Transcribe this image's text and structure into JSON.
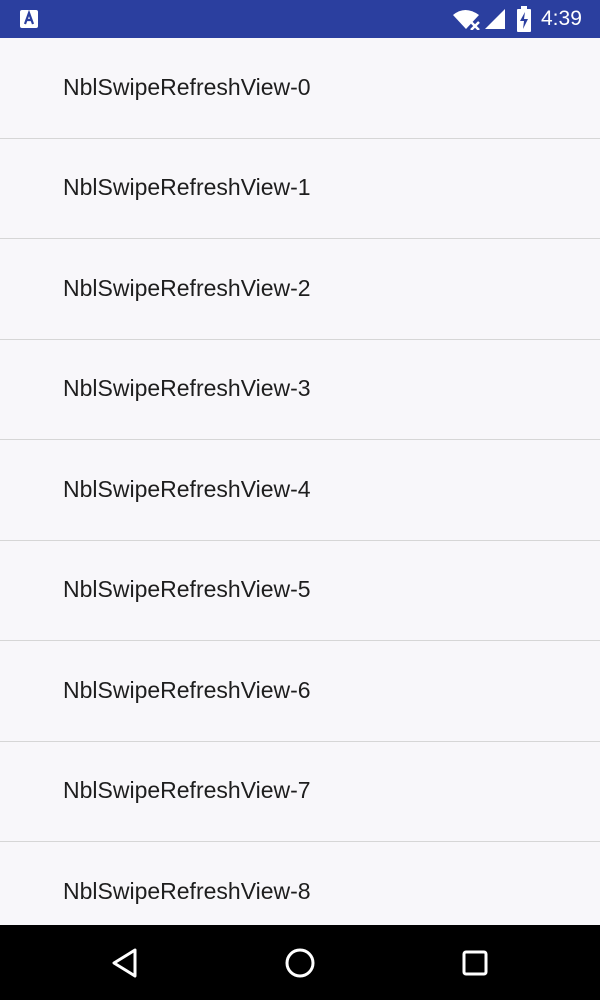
{
  "status_bar": {
    "time": "4:39",
    "app_icon": "app-notification-icon",
    "wifi_icon": "wifi-icon",
    "signal_icon": "signal-icon",
    "battery_icon": "battery-charging-icon",
    "background_color": "#2b3f9f"
  },
  "list": {
    "items": [
      {
        "label": "NblSwipeRefreshView-0"
      },
      {
        "label": "NblSwipeRefreshView-1"
      },
      {
        "label": "NblSwipeRefreshView-2"
      },
      {
        "label": "NblSwipeRefreshView-3"
      },
      {
        "label": "NblSwipeRefreshView-4"
      },
      {
        "label": "NblSwipeRefreshView-5"
      },
      {
        "label": "NblSwipeRefreshView-6"
      },
      {
        "label": "NblSwipeRefreshView-7"
      },
      {
        "label": "NblSwipeRefreshView-8"
      }
    ]
  },
  "nav_bar": {
    "back_icon": "back-triangle-icon",
    "home_icon": "home-circle-icon",
    "recents_icon": "recents-square-icon"
  }
}
